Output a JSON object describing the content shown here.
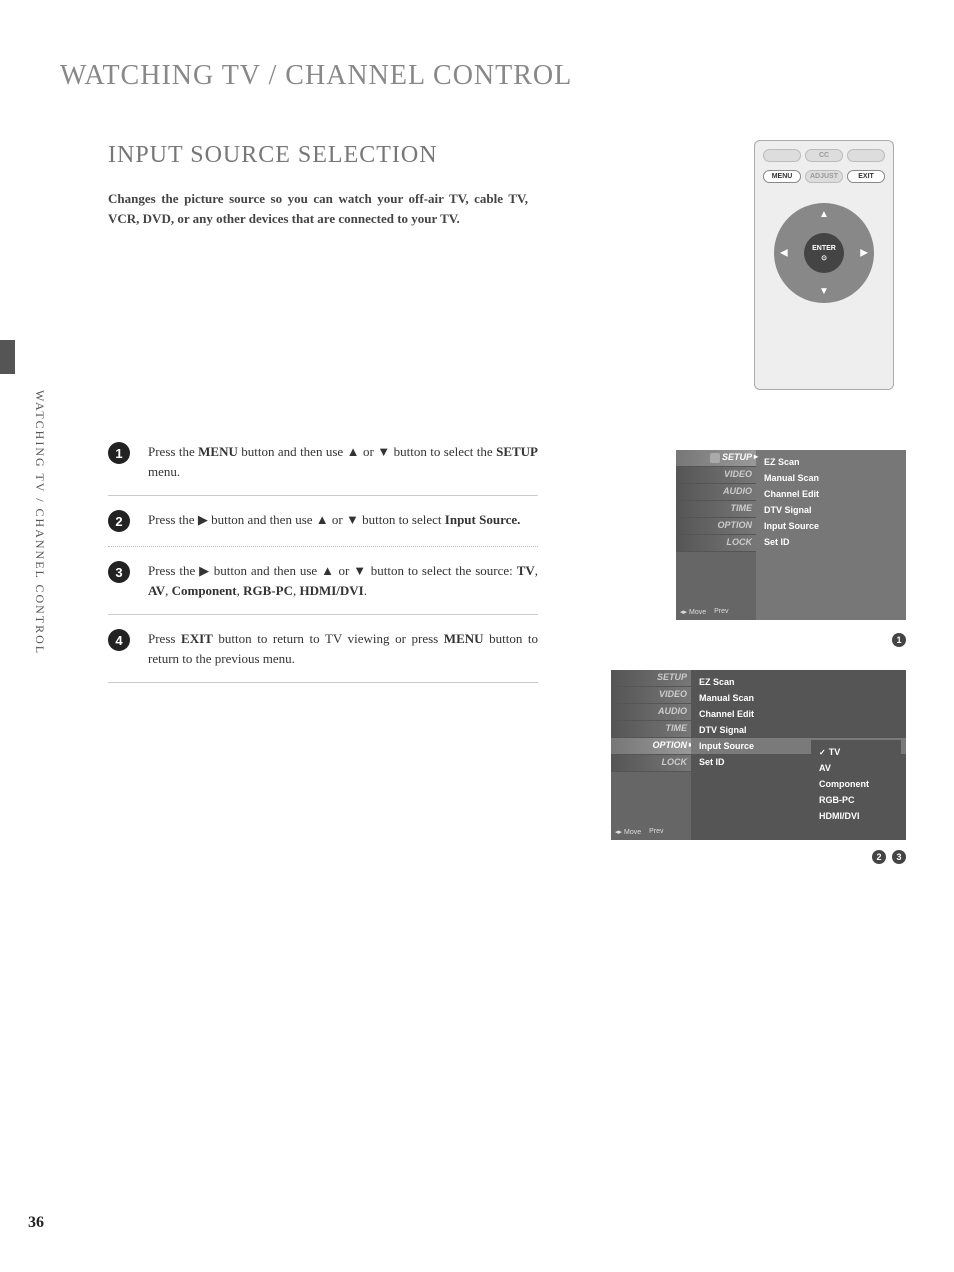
{
  "header": {
    "section": "WATCHING TV / CHANNEL CONTROL",
    "subsection": "INPUT SOURCE SELECTION",
    "intro": "Changes the picture source so you can watch your off-air TV, cable TV, VCR, DVD, or any other devices that are connected to your TV."
  },
  "side_label": "WATCHING TV / CHANNEL CONTROL",
  "remote": {
    "top_row": [
      "",
      "CC",
      ""
    ],
    "buttons": {
      "menu": "MENU",
      "adjust": "ADJUST",
      "exit": "EXIT"
    },
    "enter": "ENTER"
  },
  "steps": [
    {
      "n": "1",
      "pre": "Press the ",
      "b1": "MENU",
      "mid": " button and then use  ▲  or  ▼  button to select the ",
      "b2": "SETUP",
      "post": " menu."
    },
    {
      "n": "2",
      "pre": "Press the  ▶  button and then use  ▲  or  ▼  button to select ",
      "b1": "Input Source.",
      "mid": "",
      "b2": "",
      "post": ""
    },
    {
      "n": "3",
      "pre": "Press the  ▶  button and then use  ▲  or  ▼  button to select the source: ",
      "b1": "TV",
      "mid": ", ",
      "b2": "AV",
      "mid2": ", ",
      "b3": "Component",
      "mid3": ", ",
      "b4": "RGB-PC",
      "mid4": ", ",
      "b5": "HDMI/DVI",
      "post": "."
    },
    {
      "n": "4",
      "pre": "Press ",
      "b1": "EXIT",
      "mid": " button to return to TV viewing or press ",
      "b2": "MENU",
      "post": " button to return to the previous menu."
    }
  ],
  "osd": {
    "tabs": [
      "SETUP",
      "VIDEO",
      "AUDIO",
      "TIME",
      "OPTION",
      "LOCK"
    ],
    "setup_items": [
      "EZ Scan",
      "Manual Scan",
      "Channel Edit",
      "DTV Signal",
      "Input Source",
      "Set ID"
    ],
    "input_sources": [
      "TV",
      "AV",
      "Component",
      "RGB-PC",
      "HDMI/DVI"
    ],
    "footer_move": "Move",
    "footer_prev": "Prev"
  },
  "callouts": {
    "c1": "1",
    "c2": "2",
    "c3": "3"
  },
  "page_number": "36"
}
